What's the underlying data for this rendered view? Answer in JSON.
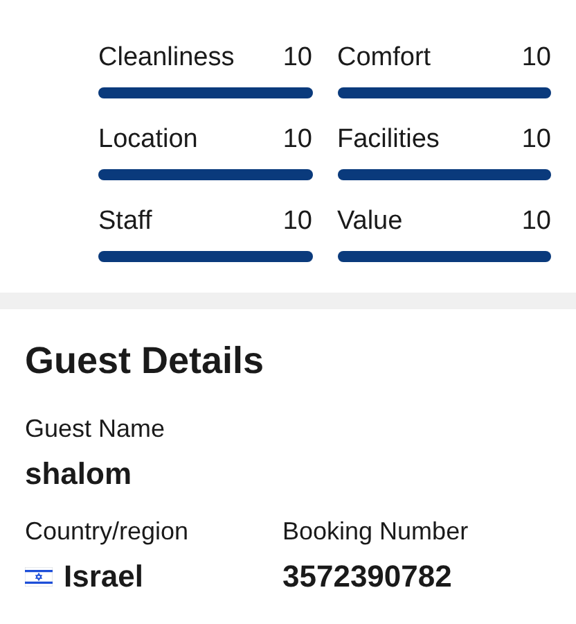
{
  "ratings": [
    {
      "label": "Cleanliness",
      "score": "10",
      "level": 1
    },
    {
      "label": "Comfort",
      "score": "10",
      "level": 1
    },
    {
      "label": "Location",
      "score": "10",
      "level": 1
    },
    {
      "label": "Facilities",
      "score": "10",
      "level": 1
    },
    {
      "label": "Staff",
      "score": "10",
      "level": 1
    },
    {
      "label": "Value",
      "score": "10",
      "level": 1
    }
  ],
  "guest_details": {
    "title": "Guest Details",
    "fields": [
      {
        "label": "Guest Name",
        "value": "shalom"
      },
      {
        "label": "Country/region",
        "value": "Israel",
        "flag": true
      },
      {
        "label": "Booking Number",
        "value": "3572390782"
      }
    ]
  }
}
